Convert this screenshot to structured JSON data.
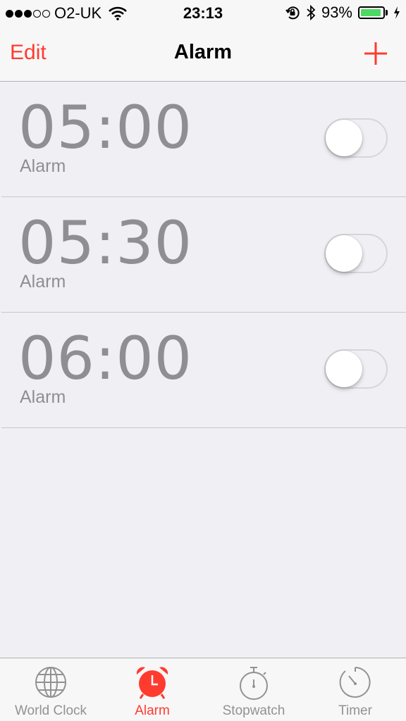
{
  "status_bar": {
    "carrier": "O2-UK",
    "time": "23:13",
    "battery_percent": "93%",
    "signal_bars_filled": 3,
    "signal_bars_total": 5,
    "battery_level": 0.93,
    "battery_color": "#4cd964"
  },
  "nav": {
    "edit_label": "Edit",
    "title": "Alarm",
    "add_icon": "plus-icon"
  },
  "alarms": [
    {
      "time": "05:00",
      "label": "Alarm",
      "enabled": false
    },
    {
      "time": "05:30",
      "label": "Alarm",
      "enabled": false
    },
    {
      "time": "06:00",
      "label": "Alarm",
      "enabled": false
    }
  ],
  "tabs": [
    {
      "label": "World Clock",
      "icon": "globe-icon",
      "active": false
    },
    {
      "label": "Alarm",
      "icon": "alarm-clock-icon",
      "active": true
    },
    {
      "label": "Stopwatch",
      "icon": "stopwatch-icon",
      "active": false
    },
    {
      "label": "Timer",
      "icon": "timer-icon",
      "active": false
    }
  ],
  "colors": {
    "accent": "#ff3b30",
    "inactive": "#929292",
    "background": "#efeff4"
  }
}
